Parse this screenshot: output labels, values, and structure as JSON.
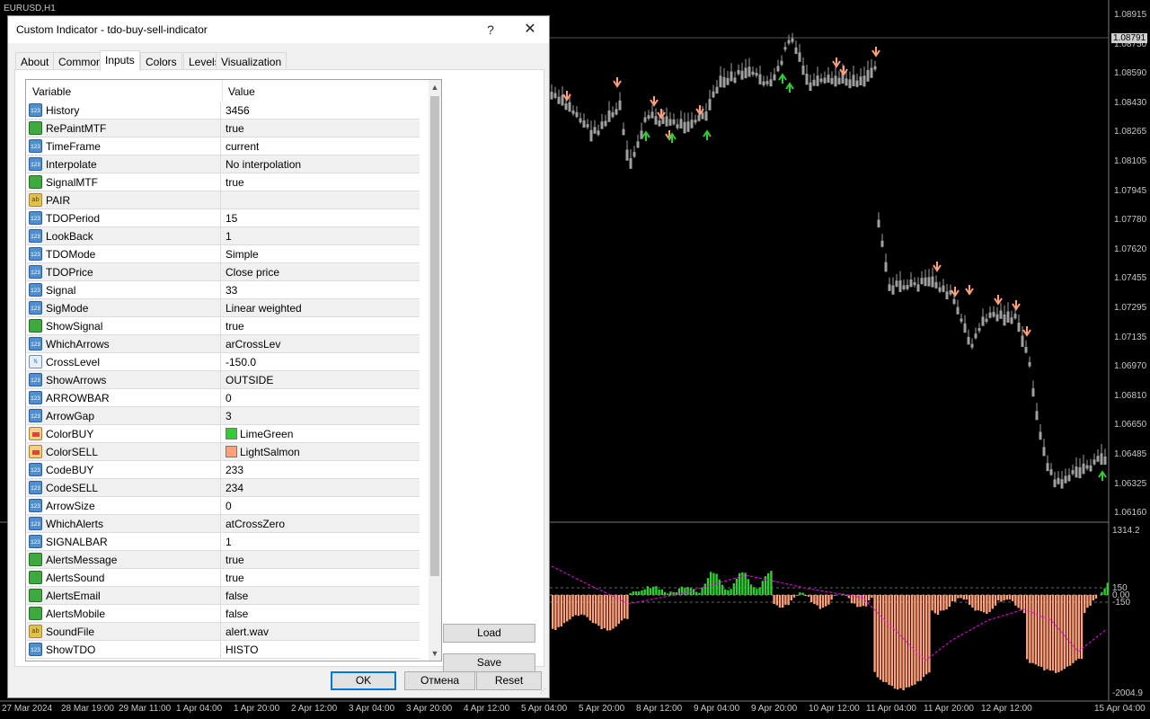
{
  "chart": {
    "symbol": "EURUSD,H1",
    "current_price": "1.08791",
    "price_axis": [
      "1.08915",
      "1.08750",
      "1.08590",
      "1.08430",
      "1.08265",
      "1.08105",
      "1.07945",
      "1.07780",
      "1.07620",
      "1.07455",
      "1.07295",
      "1.07135",
      "1.06970",
      "1.06810",
      "1.06650",
      "1.06485",
      "1.06325",
      "1.06160"
    ],
    "sub_axis": [
      "1314.2",
      "150",
      "0.00",
      "-150",
      "-2004.9"
    ],
    "time_axis": [
      "27 Mar 2024",
      "28 Mar 19:00",
      "29 Mar 11:00",
      "1 Apr 04:00",
      "1 Apr 20:00",
      "2 Apr 12:00",
      "3 Apr 04:00",
      "3 Apr 20:00",
      "4 Apr 12:00",
      "5 Apr 04:00",
      "5 Apr 20:00",
      "8 Apr 12:00",
      "9 Apr 04:00",
      "9 Apr 20:00",
      "10 Apr 12:00",
      "11 Apr 04:00",
      "11 Apr 20:00",
      "12 Apr 12:00",
      "15 Apr 04:00"
    ],
    "colors": {
      "bull_arrow": "#32CD32",
      "bear_arrow": "#FFA07A",
      "candle": "#a0a0a0",
      "histo_buy": "#32CD32",
      "histo_sell": "#FFA07A",
      "signal_line": "#ff00ff"
    }
  },
  "dialog": {
    "title": "Custom Indicator - tdo-buy-sell-indicator",
    "help_label": "?",
    "close_label": "✕",
    "tabs": [
      "About",
      "Common",
      "Inputs",
      "Colors",
      "Levels",
      "Visualization"
    ],
    "active_tab": "Inputs",
    "grid": {
      "col_variable": "Variable",
      "col_value": "Value",
      "rows": [
        {
          "type": "int",
          "icon": "123",
          "name": "History",
          "value": "3456"
        },
        {
          "type": "bool",
          "icon": "",
          "name": "RePaintMTF",
          "value": "true"
        },
        {
          "type": "int",
          "icon": "123",
          "name": "TimeFrame",
          "value": "current"
        },
        {
          "type": "int",
          "icon": "123",
          "name": "Interpolate",
          "value": "No interpolation"
        },
        {
          "type": "bool",
          "icon": "",
          "name": "SignalMTF",
          "value": "true"
        },
        {
          "type": "str",
          "icon": "ab",
          "name": "PAIR",
          "value": ""
        },
        {
          "type": "int",
          "icon": "123",
          "name": "TDOPeriod",
          "value": "15"
        },
        {
          "type": "int",
          "icon": "123",
          "name": "LookBack",
          "value": "1"
        },
        {
          "type": "int",
          "icon": "123",
          "name": "TDOMode",
          "value": "Simple"
        },
        {
          "type": "int",
          "icon": "123",
          "name": "TDOPrice",
          "value": "Close price"
        },
        {
          "type": "int",
          "icon": "123",
          "name": "Signal",
          "value": "33"
        },
        {
          "type": "int",
          "icon": "123",
          "name": "SigMode",
          "value": "Linear weighted"
        },
        {
          "type": "bool",
          "icon": "",
          "name": "ShowSignal",
          "value": "true"
        },
        {
          "type": "int",
          "icon": "123",
          "name": "WhichArrows",
          "value": "arCrossLev"
        },
        {
          "type": "dbl",
          "icon": "½",
          "name": "CrossLevel",
          "value": "-150.0"
        },
        {
          "type": "int",
          "icon": "123",
          "name": "ShowArrows",
          "value": "OUTSIDE"
        },
        {
          "type": "int",
          "icon": "123",
          "name": "ARROWBAR",
          "value": "0"
        },
        {
          "type": "int",
          "icon": "123",
          "name": "ArrowGap",
          "value": "3"
        },
        {
          "type": "clr",
          "icon": "",
          "name": "ColorBUY",
          "value": "LimeGreen",
          "swatch": "#32CD32"
        },
        {
          "type": "clr",
          "icon": "",
          "name": "ColorSELL",
          "value": "LightSalmon",
          "swatch": "#FFA07A"
        },
        {
          "type": "int",
          "icon": "123",
          "name": "CodeBUY",
          "value": "233"
        },
        {
          "type": "int",
          "icon": "123",
          "name": "CodeSELL",
          "value": "234"
        },
        {
          "type": "int",
          "icon": "123",
          "name": "ArrowSize",
          "value": "0"
        },
        {
          "type": "int",
          "icon": "123",
          "name": "WhichAlerts",
          "value": "atCrossZero"
        },
        {
          "type": "int",
          "icon": "123",
          "name": "SIGNALBAR",
          "value": "1"
        },
        {
          "type": "bool",
          "icon": "",
          "name": "AlertsMessage",
          "value": "true"
        },
        {
          "type": "bool",
          "icon": "",
          "name": "AlertsSound",
          "value": "true"
        },
        {
          "type": "bool",
          "icon": "",
          "name": "AlertsEmail",
          "value": "false"
        },
        {
          "type": "bool",
          "icon": "",
          "name": "AlertsMobile",
          "value": "false"
        },
        {
          "type": "str",
          "icon": "ab",
          "name": "SoundFile",
          "value": "alert.wav"
        },
        {
          "type": "int",
          "icon": "123",
          "name": "ShowTDO",
          "value": "HISTO"
        }
      ]
    },
    "buttons": {
      "load": "Load",
      "save": "Save",
      "ok": "OK",
      "cancel": "Отмена",
      "reset": "Reset"
    }
  }
}
